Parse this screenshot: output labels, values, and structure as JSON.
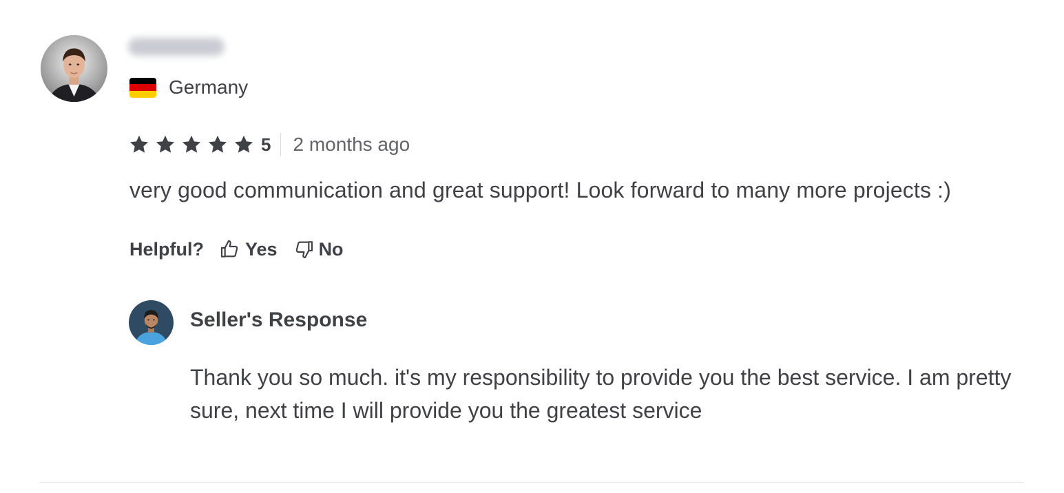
{
  "reviewer": {
    "country": "Germany",
    "flag_colors": [
      "#000000",
      "#dd0000",
      "#ffce00"
    ]
  },
  "review": {
    "rating": "5",
    "star_count": 5,
    "star_color": "#404145",
    "time_ago": "2 months ago",
    "text": "very good communication and great support! Look forward to many more projects :)"
  },
  "helpful": {
    "label": "Helpful?",
    "yes_label": "Yes",
    "no_label": "No"
  },
  "seller_response": {
    "title": "Seller's Response",
    "text": "Thank you so much. it's my responsibility to provide you the best service. I am pretty sure, next time I will provide you the greatest service"
  }
}
